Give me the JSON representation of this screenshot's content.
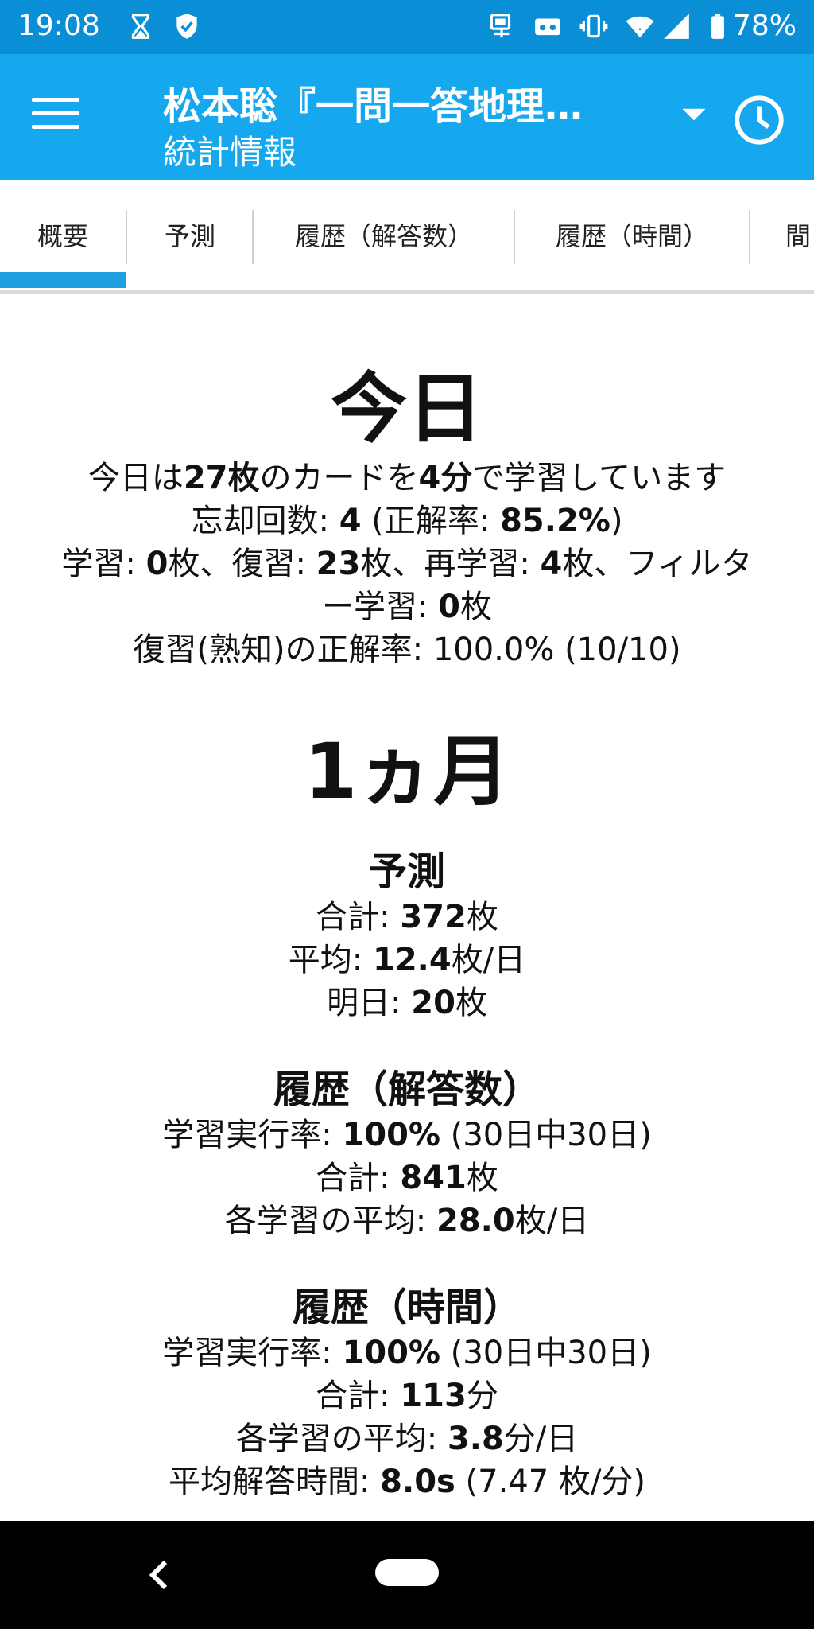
{
  "status": {
    "time": "19:08",
    "battery": "78%",
    "icons": [
      "hourglass-icon",
      "shield-check-icon",
      "key-card-icon",
      "vr-icon",
      "vibrate-icon",
      "wifi-icon",
      "signal-icon",
      "battery-icon"
    ]
  },
  "appbar": {
    "title": "松本聡『一問一答地理…",
    "subtitle": "統計情報"
  },
  "tabs": [
    "概要",
    "予測",
    "履歴（解答数）",
    "履歴（時間）",
    "間"
  ],
  "today": {
    "heading": "今日",
    "summary": {
      "pre": "今日は",
      "cards": "27枚",
      "mid": "のカードを",
      "time": "4分",
      "post": "で学習しています"
    },
    "lapses": {
      "label": "忘却回数: ",
      "count": "4",
      "pre": " (正解率: ",
      "rate": "85.2%",
      "post": ")"
    },
    "breakdown_line1": {
      "learn_label": "学習: ",
      "learn": "0",
      "learn_unit": "枚、",
      "review_label": "復習: ",
      "review": "23",
      "review_unit": "枚、",
      "relearn_label": "再学習: ",
      "relearn": "4",
      "relearn_unit": "枚、フィルタ"
    },
    "breakdown_line2": {
      "filter_label": "ー学習: ",
      "filter": "0",
      "filter_unit": "枚"
    },
    "mature": "復習(熟知)の正解率: 100.0% (10/10)"
  },
  "month": {
    "heading": "1ヵ月",
    "forecast": {
      "title": "予測",
      "total_label": "合計: ",
      "total": "372",
      "total_unit": "枚",
      "avg_label": "平均: ",
      "avg": "12.4",
      "avg_unit": "枚/日",
      "tomorrow_label": "明日: ",
      "tomorrow": "20",
      "tomorrow_unit": "枚"
    },
    "history_count": {
      "title": "履歴（解答数）",
      "rate_label": "学習実行率: ",
      "rate": "100%",
      "rate_detail": " (30日中30日)",
      "total_label": "合計: ",
      "total": "841",
      "total_unit": "枚",
      "avg_label": "各学習の平均: ",
      "avg": "28.0",
      "avg_unit": "枚/日"
    },
    "history_time": {
      "title": "履歴（時間）",
      "rate_label": "学習実行率: ",
      "rate": "100%",
      "rate_detail": " (30日中30日)",
      "total_label": "合計: ",
      "total": "113",
      "total_unit": "分",
      "avg_label": "各学習の平均: ",
      "avg": "3.8",
      "avg_unit": "分/日",
      "answer_label": "平均解答時間: ",
      "answer": "8.0s",
      "answer_detail": " (7.47 枚/分)"
    }
  },
  "colors": {
    "status_bar": "#0a8fd6",
    "app_bar": "#15a8ef",
    "tab_indicator": "#1ea0e3",
    "nav_bar": "#000000"
  }
}
